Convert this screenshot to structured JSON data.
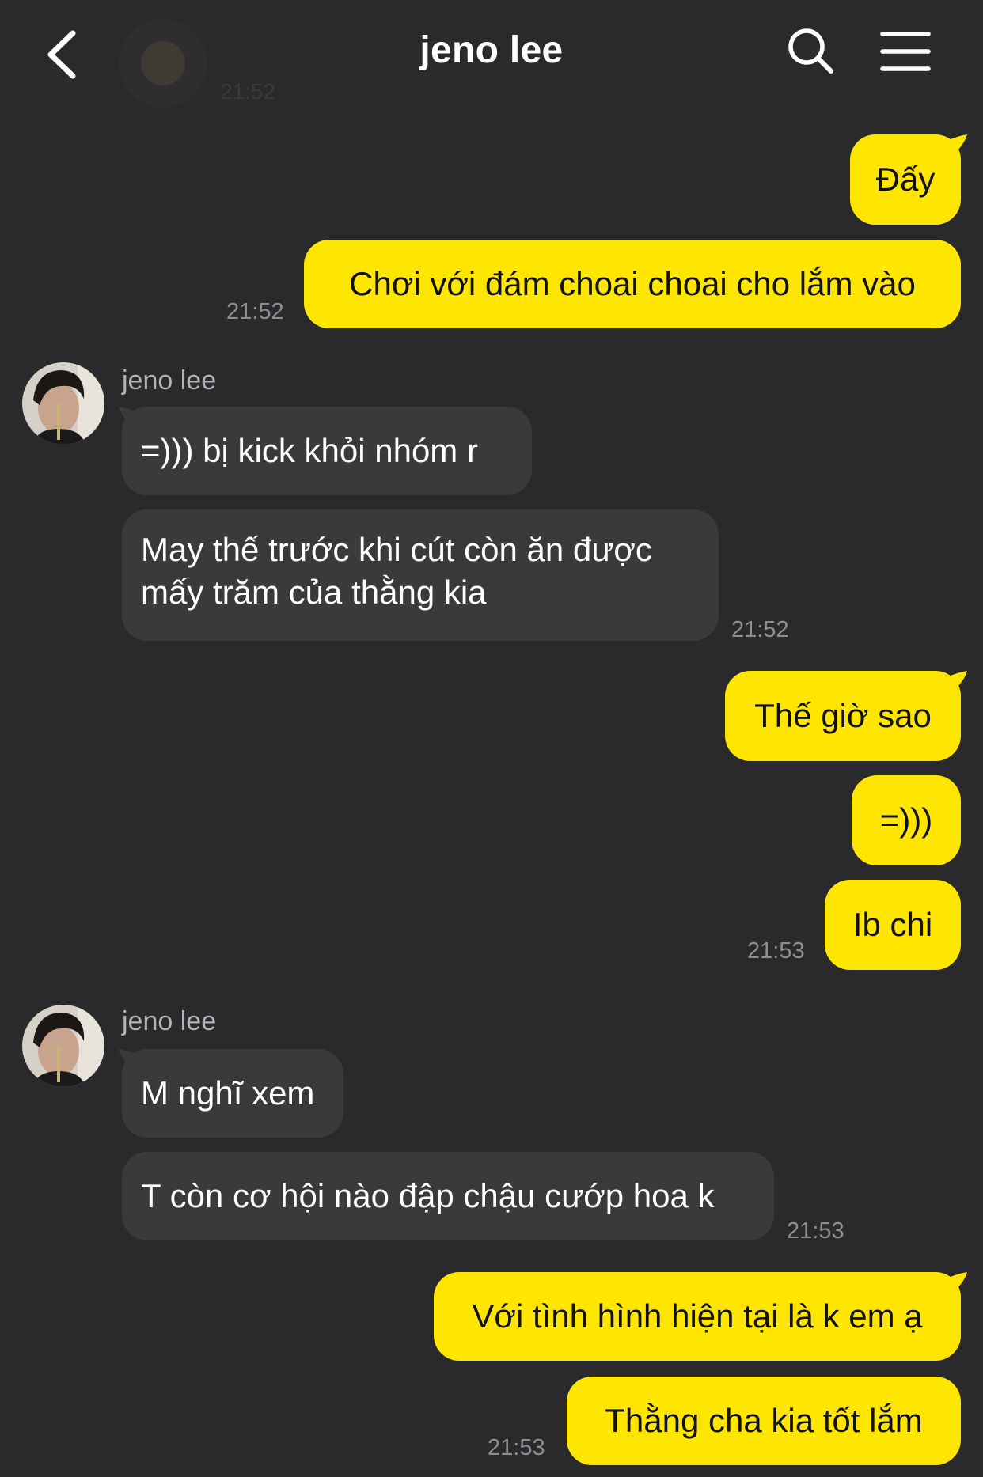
{
  "header": {
    "title": "jeno lee",
    "back_icon": "chevron-left-icon",
    "search_icon": "search-icon",
    "menu_icon": "hamburger-menu-icon",
    "ghost_time": "21:52"
  },
  "colors": {
    "background": "#2a2a2c",
    "outgoing_bubble": "#ffe600",
    "incoming_bubble": "#3a3a3c",
    "timestamp": "#8e8e93"
  },
  "messages": {
    "m1": {
      "text": "Đấy"
    },
    "m2": {
      "text": "Chơi với đám choai choai cho lắm vào",
      "time": "21:52"
    },
    "g1": {
      "sender": "jeno lee"
    },
    "m3": {
      "text": "=))) bị kick khỏi nhóm r"
    },
    "m4": {
      "text": "May thế trước khi cút còn ăn được mấy trăm của thằng kia",
      "time": "21:52"
    },
    "m5": {
      "text": "Thế giờ sao"
    },
    "m6": {
      "text": "=)))"
    },
    "m7": {
      "text": "Ib chi",
      "time": "21:53"
    },
    "g2": {
      "sender": "jeno lee"
    },
    "m8": {
      "text": "M nghĩ xem"
    },
    "m9": {
      "text": "T còn cơ hội nào đập chậu cướp hoa k",
      "time": "21:53"
    },
    "m10": {
      "text": "Với tình hình hiện tại là k em ạ"
    },
    "m11": {
      "text": "Thằng cha kia tốt lắm",
      "time": "21:53"
    }
  }
}
